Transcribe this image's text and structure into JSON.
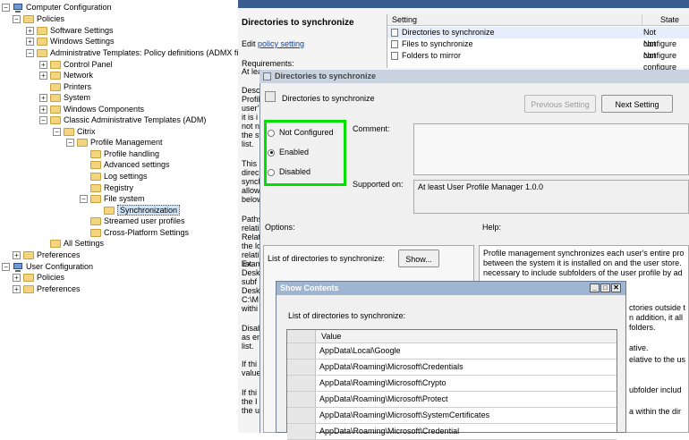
{
  "tree": {
    "computer_config": "Computer Configuration",
    "policies": "Policies",
    "software_settings": "Software Settings",
    "windows_settings": "Windows Settings",
    "admin_templates": "Administrative Templates: Policy definitions (ADMX file",
    "control_panel": "Control Panel",
    "network": "Network",
    "printers": "Printers",
    "system": "System",
    "windows_components": "Windows Components",
    "classic_admin": "Classic Administrative Templates (ADM)",
    "citrix": "Citrix",
    "profile_management": "Profile Management",
    "profile_handling": "Profile handling",
    "advanced_settings": "Advanced settings",
    "log_settings": "Log settings",
    "registry": "Registry",
    "file_system": "File system",
    "synchronization": "Synchronization",
    "streamed_user_profiles": "Streamed user profiles",
    "cross_platform": "Cross-Platform Settings",
    "all_settings": "All Settings",
    "preferences": "Preferences",
    "user_config": "User Configuration",
    "user_policies": "Policies",
    "user_preferences": "Preferences"
  },
  "detail": {
    "heading": "Directories to synchronize",
    "edit_prefix": "Edit",
    "edit_link": "policy setting",
    "requirements": "Requirements:",
    "at_least": "At leas",
    "desc_fragments": [
      "Desc",
      "Profil",
      "user'",
      "it is i",
      "not n",
      "the sy",
      "list.",
      "This s",
      "direc",
      "synch",
      "allow",
      "below",
      "Paths",
      "relati",
      "Relat",
      "the lo",
      "relati",
      "list.",
      "Exam",
      "Desk",
      "subf",
      "Desk",
      "C:\\M",
      "withi",
      "Disab",
      "as en",
      "list.",
      "If thi",
      "value",
      "If thi",
      "the I",
      "the u"
    ]
  },
  "settings_table": {
    "col_setting": "Setting",
    "col_state": "State",
    "rows": [
      {
        "name": "Directories to synchronize",
        "state": "Not configure"
      },
      {
        "name": "Files to synchronize",
        "state": "Not configure"
      },
      {
        "name": "Folders to mirror",
        "state": "Not configure"
      }
    ]
  },
  "dialog": {
    "title": "Directories to synchronize",
    "setting_name": "Directories to synchronize",
    "prev_button": "Previous Setting",
    "next_button": "Next Setting",
    "radio_not_configured": "Not Configured",
    "radio_enabled": "Enabled",
    "radio_disabled": "Disabled",
    "selected_radio": "Enabled",
    "comment_label": "Comment:",
    "supported_label": "Supported on:",
    "supported_value": "At least User Profile Manager 1.0.0",
    "options_label": "Options:",
    "help_label": "Help:",
    "list_label": "List of directories to synchronize:",
    "show_button": "Show...",
    "help_lines": [
      "Profile management synchronizes each user's entire pro",
      "between the system it is installed on and the user store.",
      "necessary to include subfolders of the user profile by ad"
    ],
    "help_fragments": [
      "ctories outside t",
      "n addition, it all",
      "folders.",
      "ative.",
      "elative to the us",
      "ubfolder includ",
      "a within the dir"
    ]
  },
  "show_contents": {
    "title": "Show Contents",
    "list_label": "List of directories to synchronize:",
    "col_value": "Value",
    "values": [
      "AppData\\Local\\Google",
      "AppData\\Roaming\\Microsoft\\Credentials",
      "AppData\\Roaming\\Microsoft\\Crypto",
      "AppData\\Roaming\\Microsoft\\Protect",
      "AppData\\Roaming\\Microsoft\\SystemCertificates",
      "AppData\\Roaming\\Microsoft\\Credential"
    ]
  },
  "colors": {
    "highlight_border": "#00e000",
    "title_bar": "#9fb6d3"
  }
}
